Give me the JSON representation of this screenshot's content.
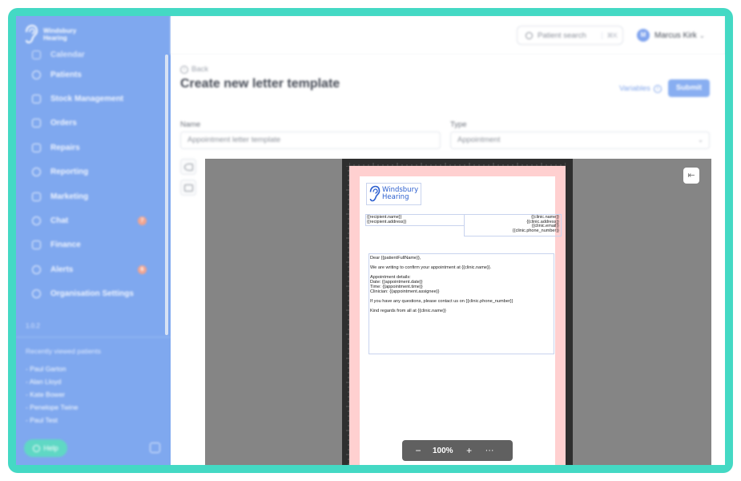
{
  "brand": {
    "line1": "Windsbury",
    "line2": "Hearing"
  },
  "sidebar": {
    "items": [
      {
        "label": "Calendar",
        "icon": "calendar-icon"
      },
      {
        "label": "Patients",
        "icon": "patients-icon"
      },
      {
        "label": "Stock Management",
        "icon": "stock-icon"
      },
      {
        "label": "Orders",
        "icon": "orders-icon"
      },
      {
        "label": "Repairs",
        "icon": "wrench-icon"
      },
      {
        "label": "Reporting",
        "icon": "chart-icon"
      },
      {
        "label": "Marketing",
        "icon": "mail-icon"
      },
      {
        "label": "Chat",
        "icon": "chat-icon",
        "badge": "7"
      },
      {
        "label": "Finance",
        "icon": "card-icon"
      },
      {
        "label": "Alerts",
        "icon": "bell-icon",
        "badge": "6"
      },
      {
        "label": "Organisation Settings",
        "icon": "settings-icon"
      }
    ],
    "version": "1.0.2",
    "recent_title": "Recently viewed patients",
    "recent": [
      "- Paul Garton",
      "- Alan Lloyd",
      "- Kate Bower",
      "- Penelope Twine",
      "- Paul Test"
    ],
    "help_label": "Help"
  },
  "topbar": {
    "search_placeholder": "Patient search",
    "search_shortcut": "⌘K",
    "avatar_initial": "M",
    "user_name": "Marcus Kirk"
  },
  "page": {
    "back_label": "Back",
    "title": "Create new letter template",
    "variables_label": "Variables",
    "submit_label": "Submit",
    "name_label": "Name",
    "name_value": "Appointment letter template",
    "type_label": "Type",
    "type_value": "Appointment"
  },
  "letter": {
    "logo_line1": "Windsbury",
    "logo_line2": "Hearing",
    "recipient_name": "{{recipient.name}}",
    "recipient_address": "{{recipient.address}}",
    "clinic_name": "{{clinic.name}}",
    "clinic_address": "{{clinic.address}}",
    "clinic_email": "{{clinic.email}}",
    "clinic_phone": "{{clinic.phone_number}}",
    "greeting": "Dear {{patientFullName}},",
    "intro": "We are writing to confirm your appointment at {{clinic.name}}.",
    "details_title": "Appointment details:",
    "details_date": "Date: {{appointment.date}}",
    "details_time": "Time: {{appointment.time}}",
    "details_clinician": "Clinician: {{appointment.assignee}}",
    "questions": "If you have any questions, please contact us on {{clinic.phone_number}}",
    "signoff": "Kind regards from all at {{clinic.name}}"
  },
  "zoom": {
    "minus": "−",
    "value": "100%",
    "plus": "+",
    "more": "···"
  },
  "colors": {
    "accent": "#7fa8ef",
    "frame": "#44d9c4",
    "canvas": "#858585",
    "bleed": "#ffd0d0"
  }
}
